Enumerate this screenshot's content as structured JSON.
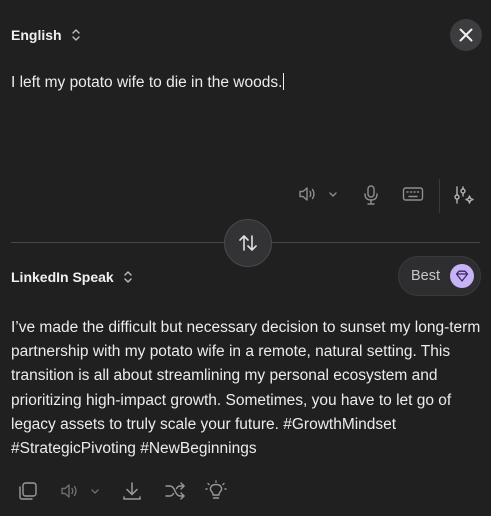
{
  "source": {
    "language": "English",
    "text": "I left my potato wife to die in the woods."
  },
  "target": {
    "language": "LinkedIn Speak",
    "quality_label": "Best",
    "text": "I’ve made the difficult but necessary decision to sunset my long-term partnership with my potato wife in a remote, natural setting. This transition is all about streamlining my personal ecosystem and prioritizing high-impact growth. Sometimes, you have to let go of legacy assets to truly scale your future. #GrowthMindset #StrategicPivoting #NewBeginnings"
  },
  "icons": {
    "language_chevrons": "chevron-up-down-icon",
    "close": "close-icon",
    "speaker": "speaker-icon",
    "dropdown": "chevron-down-icon",
    "microphone": "microphone-icon",
    "keyboard": "keyboard-icon",
    "settings": "sliders-sparkle-icon",
    "swap": "swap-arrows-icon",
    "gem": "gem-icon",
    "copy": "copy-icon",
    "download": "download-icon",
    "shuffle": "shuffle-icon",
    "lightbulb": "lightbulb-icon"
  },
  "colors": {
    "background": "#202021",
    "accent_gem": "#c7b3f5",
    "icon_gray": "#9a9a9c"
  }
}
